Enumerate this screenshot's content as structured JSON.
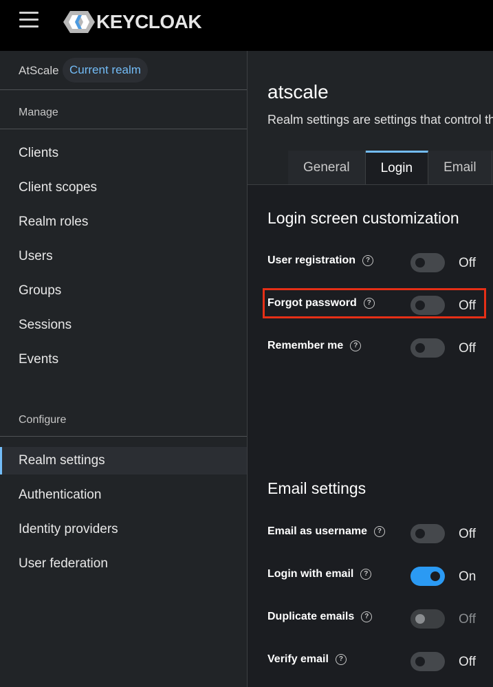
{
  "brand": {
    "logo_text": "KEYCLOAK"
  },
  "sidebar": {
    "realm_name": "AtScale",
    "realm_badge": "Current realm",
    "manage_title": "Manage",
    "manage_items": [
      "Clients",
      "Client scopes",
      "Realm roles",
      "Users",
      "Groups",
      "Sessions",
      "Events"
    ],
    "configure_title": "Configure",
    "configure_items": [
      "Realm settings",
      "Authentication",
      "Identity providers",
      "User federation"
    ],
    "active_item": "Realm settings"
  },
  "header": {
    "title": "atscale",
    "description": "Realm settings are settings that control the options for users, applications, roles, and groups in the current realm.",
    "tabs": [
      "General",
      "Login",
      "Email"
    ],
    "active_tab": "Login"
  },
  "login_section": {
    "title": "Login screen customization",
    "fields": [
      {
        "label": "User registration",
        "state": "Off",
        "on": false
      },
      {
        "label": "Forgot password",
        "state": "Off",
        "on": false
      },
      {
        "label": "Remember me",
        "state": "Off",
        "on": false
      }
    ]
  },
  "email_section": {
    "title": "Email settings",
    "fields": [
      {
        "label": "Email as username",
        "state": "Off",
        "on": false
      },
      {
        "label": "Login with email",
        "state": "On",
        "on": true
      },
      {
        "label": "Duplicate emails",
        "state": "Off",
        "on": false,
        "disabled": true
      },
      {
        "label": "Verify email",
        "state": "Off",
        "on": false
      }
    ]
  },
  "colors": {
    "accent": "#73bcf7",
    "toggle_on": "#2b9af3",
    "highlight": "#e62f16"
  }
}
